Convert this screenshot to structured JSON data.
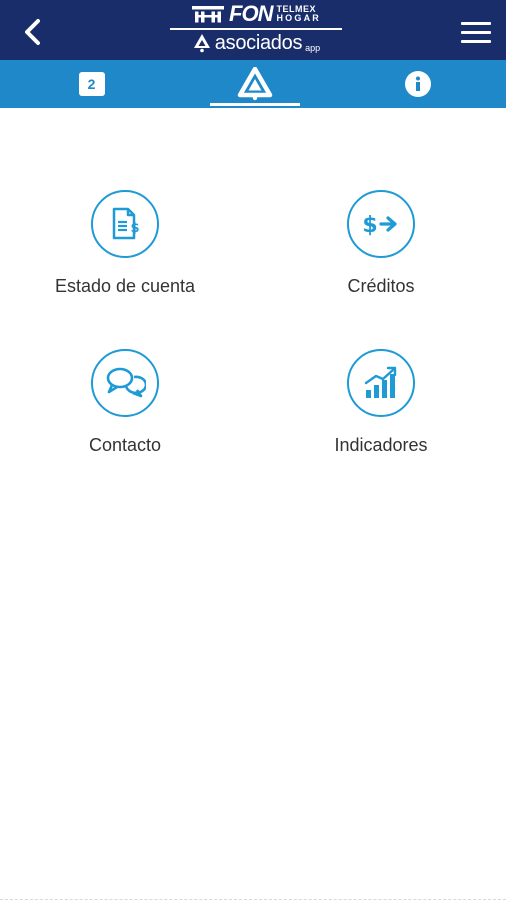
{
  "header": {
    "logo": {
      "fon": "FON",
      "telmex": "TELMEX",
      "hogar": "HOGAR",
      "asociados": "asociados",
      "app": "app"
    }
  },
  "tabs": [
    {
      "id": "notifications",
      "badge": "2",
      "icon": "notification-badge-icon"
    },
    {
      "id": "home",
      "icon": "asociados-logo-icon",
      "active": true
    },
    {
      "id": "info",
      "icon": "info-icon"
    }
  ],
  "menu": [
    {
      "label": "Estado de cuenta",
      "icon": "account-statement-icon"
    },
    {
      "label": "Créditos",
      "icon": "credits-icon"
    },
    {
      "label": "Contacto",
      "icon": "chat-bubbles-icon"
    },
    {
      "label": "Indicadores",
      "icon": "bar-chart-icon"
    }
  ],
  "colors": {
    "header": "#1a2d6b",
    "tabbar": "#1e88c8",
    "accent": "#1e9ad6",
    "text": "#333333"
  }
}
